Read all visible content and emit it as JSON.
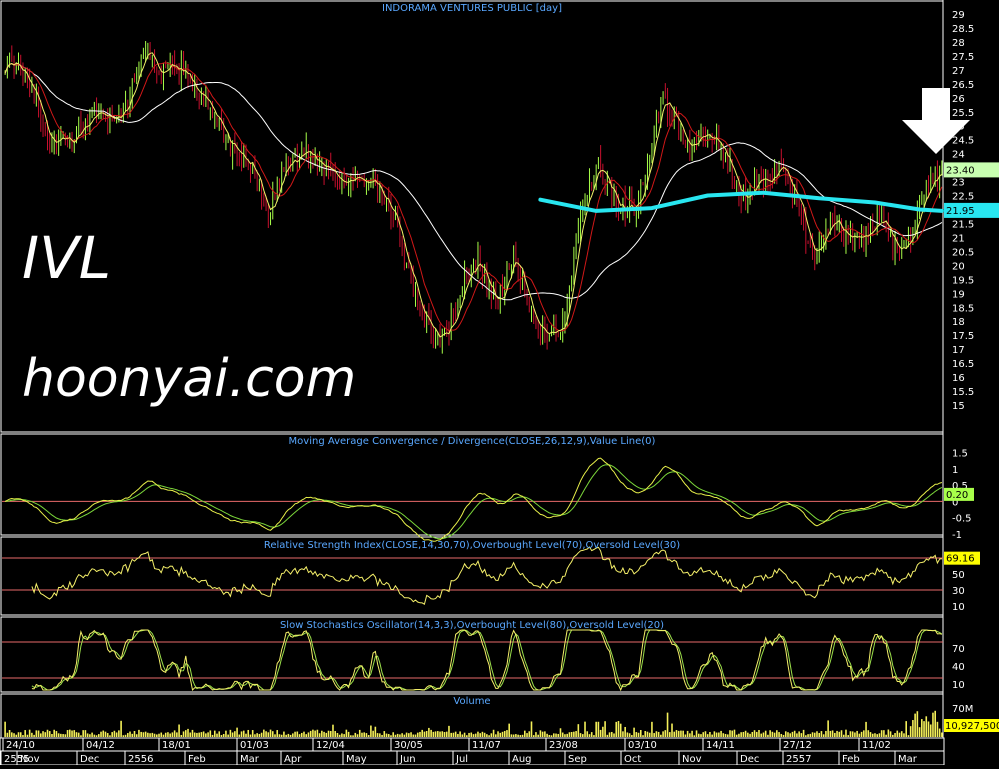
{
  "colors": {
    "background": "#000000",
    "price_up": "#a8ff4a",
    "price_down": "#c8102e",
    "ma_fast": "#f2f26a",
    "ma_mid": "#d01818",
    "ma_slow": "#ffffff",
    "trend_line": "#28e6f0",
    "macd_line": "#e8f04a",
    "signal_line": "#7bd63a",
    "rsi_line": "#f5f06a",
    "stoch_k": "#f5f06a",
    "stoch_d": "#9be04a",
    "volume": "#f5f05a",
    "level_line": "#e86a6a",
    "panel_title": "#5aa8ff",
    "axis_text": "#ffffff",
    "arrow": "#ffffff",
    "watermark": "#ffffff"
  },
  "watermark": {
    "ticker": "IVL",
    "site": "hoonyai.com"
  },
  "arrow_icon": "down-arrow-icon",
  "axis": {
    "date_labels_top": [
      "24/10",
      "04/12",
      "18/01",
      "01/03",
      "12/04",
      "30/05",
      "11/07",
      "23/08",
      "03/10",
      "14/11",
      "27/12",
      "11/02"
    ],
    "date_labels_bottom": [
      "2555",
      "Nov",
      "Dec",
      "2556",
      "Feb",
      "Mar",
      "Apr",
      "May",
      "Jun",
      "Jul",
      "Aug",
      "Sep",
      "Oct",
      "Nov",
      "Dec",
      "2557",
      "Feb",
      "Mar"
    ]
  },
  "chart_data": [
    {
      "type": "candlestick",
      "title": "INDORAMA VENTURES PUBLIC [day]",
      "ylim": [
        15,
        29
      ],
      "yticks": [
        "29",
        "28.5",
        "28",
        "27.5",
        "27",
        "26.5",
        "26",
        "25.5",
        "25",
        "24.5",
        "24",
        "23.5",
        "23",
        "22.5",
        "22",
        "21.5",
        "21",
        "20.5",
        "20",
        "19.5",
        "19",
        "18.5",
        "18",
        "17.5",
        "17",
        "16.5",
        "16",
        "15.5",
        "15"
      ],
      "last_price_label": "23.40",
      "last_price": 23.4,
      "trend_level_label": "21.95",
      "trend_level": 21.95,
      "close_anchors": [
        [
          0,
          27.2
        ],
        [
          10,
          26.8
        ],
        [
          20,
          24.5
        ],
        [
          30,
          24.4
        ],
        [
          40,
          25.6
        ],
        [
          48,
          25.2
        ],
        [
          55,
          25.8
        ],
        [
          62,
          27.8
        ],
        [
          70,
          26.9
        ],
        [
          80,
          27.0
        ],
        [
          90,
          25.8
        ],
        [
          100,
          24.3
        ],
        [
          110,
          23.6
        ],
        [
          118,
          21.9
        ],
        [
          125,
          23.5
        ],
        [
          135,
          24.1
        ],
        [
          145,
          23.4
        ],
        [
          155,
          23.0
        ],
        [
          165,
          22.9
        ],
        [
          175,
          21.5
        ],
        [
          185,
          18.5
        ],
        [
          192,
          17.6
        ],
        [
          198,
          17.4
        ],
        [
          206,
          19.5
        ],
        [
          212,
          20.2
        ],
        [
          220,
          18.5
        ],
        [
          228,
          20.3
        ],
        [
          236,
          18.1
        ],
        [
          244,
          17.5
        ],
        [
          250,
          17.8
        ],
        [
          258,
          22.0
        ],
        [
          266,
          23.5
        ],
        [
          274,
          22.2
        ],
        [
          282,
          22.1
        ],
        [
          288,
          23.6
        ],
        [
          295,
          26.0
        ],
        [
          300,
          25.2
        ],
        [
          306,
          24.3
        ],
        [
          315,
          24.7
        ],
        [
          322,
          24.0
        ],
        [
          330,
          22.6
        ],
        [
          340,
          22.9
        ],
        [
          346,
          23.6
        ],
        [
          354,
          22.5
        ],
        [
          362,
          20.2
        ],
        [
          370,
          21.5
        ],
        [
          378,
          21.0
        ],
        [
          386,
          21.1
        ],
        [
          392,
          21.6
        ],
        [
          398,
          20.8
        ],
        [
          404,
          20.5
        ],
        [
          410,
          22.2
        ],
        [
          416,
          23.1
        ],
        [
          420,
          23.4
        ]
      ],
      "sma_trend": [
        [
          240,
          22.35
        ],
        [
          265,
          21.95
        ],
        [
          290,
          22.05
        ],
        [
          315,
          22.5
        ],
        [
          340,
          22.6
        ],
        [
          365,
          22.4
        ],
        [
          390,
          22.25
        ],
        [
          410,
          22.0
        ],
        [
          420,
          21.95
        ]
      ]
    },
    {
      "type": "line",
      "title": "Moving Average Convergence / Divergence(CLOSE,26,12,9),Value Line(0)",
      "ylim": [
        -1.0,
        1.7
      ],
      "yticks": [
        "1.5",
        "1",
        "0.5",
        "0",
        "-0.5",
        "-1"
      ],
      "last_value_label": "0.20",
      "last_value": 0.2,
      "value_line": 0
    },
    {
      "type": "line",
      "title": "Relative Strength Index(CLOSE,14,30,70),Overbought Level(70),Oversold Level(30)",
      "ylim": [
        0,
        80
      ],
      "yticks": [
        "70",
        "50",
        "30",
        "10"
      ],
      "last_value_label": "69.16",
      "last_value": 69.16,
      "overbought": 70,
      "oversold": 30
    },
    {
      "type": "line",
      "title": "Slow Stochastics Oscillator(14,3,3),Overbought Level(80),Oversold Level(20)",
      "ylim": [
        0,
        100
      ],
      "yticks": [
        "70",
        "40",
        "10"
      ],
      "overbought": 80,
      "oversold": 20
    },
    {
      "type": "bar",
      "title": "Volume",
      "yticks": [
        "70M"
      ],
      "ylim": [
        0,
        90000000
      ],
      "last_value_label": "10,927,500",
      "last_value": 10927500
    }
  ]
}
